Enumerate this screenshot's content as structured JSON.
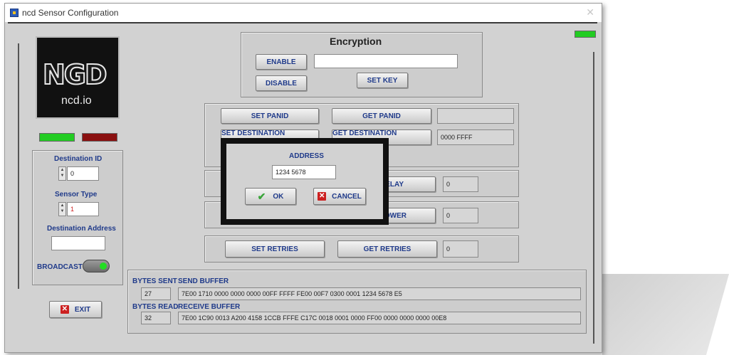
{
  "window": {
    "title": "ncd Sensor Configuration"
  },
  "logo": {
    "main": "NGD",
    "sub": "ncd.io"
  },
  "encryption": {
    "heading": "Encryption",
    "enable_label": "ENABLE",
    "disable_label": "DISABLE",
    "key_value": "",
    "set_key_label": "SET KEY"
  },
  "network": {
    "set_panid_label": "SET PANID",
    "get_panid_label": "GET PANID",
    "panid_value": "",
    "set_dest_label": "SET DESTINATION ADDRESS",
    "get_dest_label": "GET DESTINATION ADDRESS",
    "dest_value": "0000 FFFF"
  },
  "delay": {
    "get_label_partial": "ELAY",
    "value": "0"
  },
  "power": {
    "get_label_partial": "OWER",
    "value": "0"
  },
  "retries": {
    "set_label": "SET RETRIES",
    "get_label": "GET RETRIES",
    "value": "0"
  },
  "left_panel": {
    "destination_id_label": "Destination ID",
    "destination_id_value": "0",
    "sensor_type_label": "Sensor Type",
    "sensor_type_value": "1",
    "destination_address_label": "Destination Address",
    "destination_address_value": "",
    "broadcast_label": "BROADCAST",
    "exit_label": "EXIT"
  },
  "buffers": {
    "bytes_sent_label": "BYTES SENT",
    "bytes_sent_value": "27",
    "send_buffer_label": "SEND BUFFER",
    "send_buffer_value": "7E00 1710 0000 0000 0000 00FF FFFF FE00 00F7 0300 0001 1234 5678 E5",
    "bytes_read_label": "BYTES READ",
    "bytes_read_value": "32",
    "receive_buffer_label": "RECEIVE BUFFER",
    "receive_buffer_value": "7E00 1C90 0013 A200 4158 1CCB FFFE C17C 0018 0001 0000 FF00 0000 0000 0000 00E8"
  },
  "dialog": {
    "title": "ADDRESS",
    "value": "1234 5678",
    "ok_label": "OK",
    "cancel_label": "CANCEL"
  },
  "colors": {
    "status_green": "#22cc22",
    "status_red": "#8a1010",
    "label_blue": "#1f3a8a",
    "panel_gray": "#d2d2d2"
  }
}
